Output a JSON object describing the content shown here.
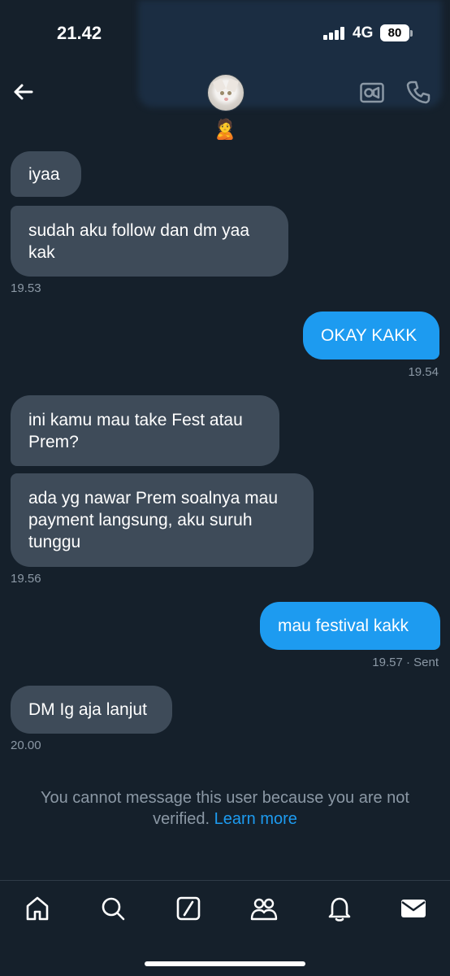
{
  "status_bar": {
    "time": "21.42",
    "network": "4G",
    "battery": "80"
  },
  "header": {
    "back_icon": "arrow-left-icon",
    "avatar_icon": "white-cat-avatar",
    "user_emoji": "🙎",
    "video_icon": "video-camera-icon",
    "phone_icon": "phone-icon"
  },
  "messages": [
    {
      "direction": "in",
      "lines": [
        "iyaa"
      ]
    },
    {
      "direction": "in",
      "lines": [
        "sudah aku follow dan dm yaa",
        "kak"
      ],
      "time": "19.53"
    },
    {
      "direction": "out",
      "lines": [
        "OKAY KAKK"
      ],
      "time": "19.54"
    },
    {
      "direction": "in",
      "lines": [
        "ini kamu mau take Fest atau",
        "Prem?"
      ]
    },
    {
      "direction": "in",
      "lines": [
        "ada yg nawar Prem soalnya mau",
        "payment langsung, aku suruh",
        "tunggu"
      ],
      "time": "19.56"
    },
    {
      "direction": "out",
      "lines": [
        "mau festival kakk"
      ],
      "time": "19.57 · Sent"
    },
    {
      "direction": "in",
      "lines": [
        "DM Ig aja lanjut"
      ],
      "time": "20.00"
    }
  ],
  "notice": {
    "line1": "You cannot message this user because you are not",
    "line2": "verified.",
    "link": "Learn more"
  },
  "bottom_nav": {
    "items": [
      "home-icon",
      "search-icon",
      "grok-icon",
      "communities-icon",
      "notifications-icon",
      "messages-icon"
    ]
  },
  "colors": {
    "background": "#15202b",
    "incoming_bubble": "#3e4b59",
    "outgoing_bubble": "#1d9bf0",
    "muted_text": "#8b98a5"
  }
}
